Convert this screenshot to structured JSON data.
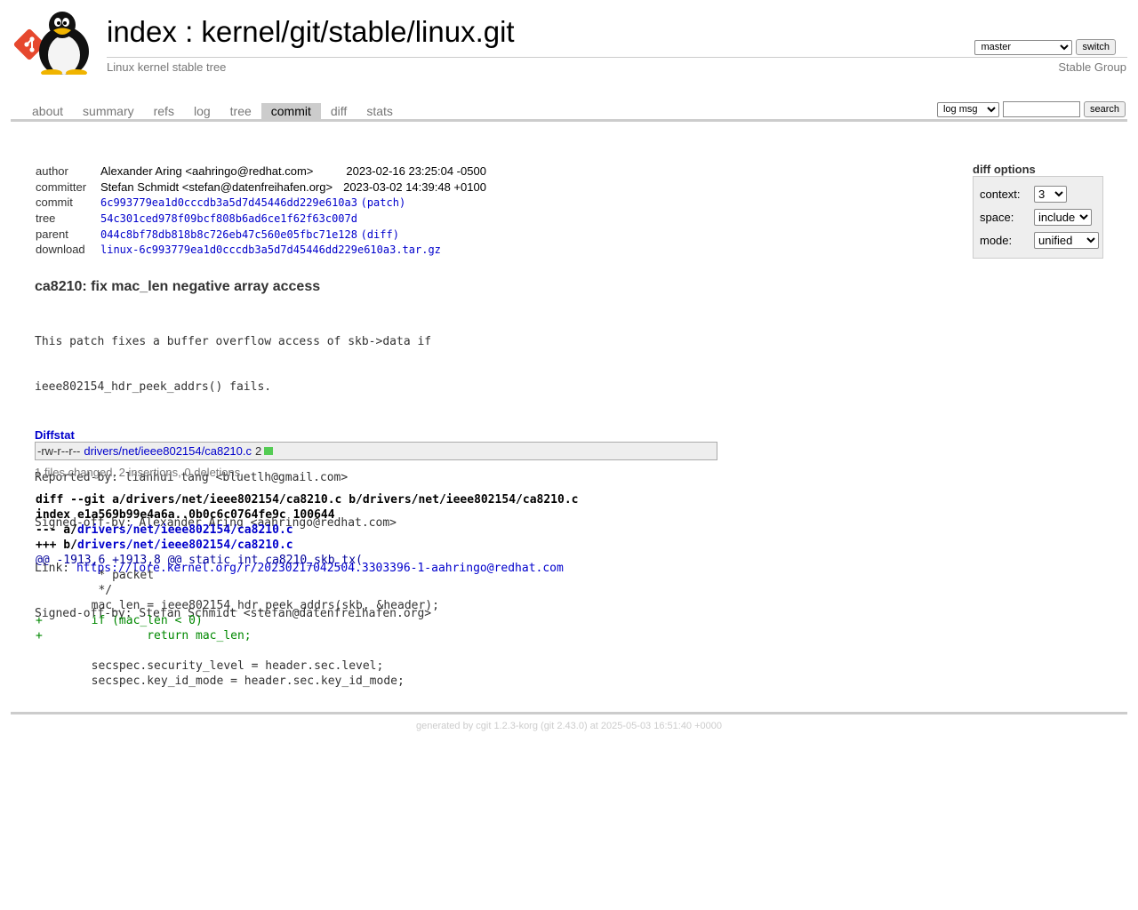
{
  "header": {
    "index_label": "index",
    "separator": ":",
    "repo_path": "kernel/git/stable/linux.git",
    "subtitle": "Linux kernel stable tree",
    "owner": "Stable Group",
    "branch_selected": "master",
    "switch_label": "switch"
  },
  "tabs": [
    {
      "label": "about"
    },
    {
      "label": "summary"
    },
    {
      "label": "refs"
    },
    {
      "label": "log"
    },
    {
      "label": "tree"
    },
    {
      "label": "commit",
      "active": true
    },
    {
      "label": "diff"
    },
    {
      "label": "stats"
    }
  ],
  "search": {
    "mode_selected": "log msg",
    "query": "",
    "button_label": "search"
  },
  "commit_info": {
    "author_label": "author",
    "author": "Alexander Aring <aahringo@redhat.com>",
    "author_date": "2023-02-16 23:25:04 -0500",
    "committer_label": "committer",
    "committer": "Stefan Schmidt <stefan@datenfreihafen.org>",
    "committer_date": "2023-03-02 14:39:48 +0100",
    "commit_label": "commit",
    "commit_hash": "6c993779ea1d0cccdb3a5d7d45446dd229e610a3",
    "patch_label": "(patch)",
    "tree_label": "tree",
    "tree_hash": "54c301ced978f09bcf808b6ad6ce1f62f63c007d",
    "parent_label": "parent",
    "parent_hash": "044c8bf78db818b8c726eb47c560e05fbc71e128",
    "diff_label": "(diff)",
    "download_label": "download",
    "download_file": "linux-6c993779ea1d0cccdb3a5d7d45446dd229e610a3.tar.gz"
  },
  "diff_options": {
    "title": "diff options",
    "context_label": "context:",
    "context_value": "3",
    "space_label": "space:",
    "space_value": "include",
    "mode_label": "mode:",
    "mode_value": "unified"
  },
  "commit": {
    "subject": "ca8210: fix mac_len negative array access",
    "message_lines": [
      "This patch fixes a buffer overflow access of skb->data if",
      "ieee802154_hdr_peek_addrs() fails.",
      "",
      "Reported-by: lianhui tang <bluetlh@gmail.com>",
      "Signed-off-by: Alexander Aring <aahringo@redhat.com>"
    ],
    "link_prefix": "Link: ",
    "link_url": "https://lore.kernel.org/r/20230217042504.3303396-1-aahringo@redhat.com",
    "message_tail": "Signed-off-by: Stefan Schmidt <stefan@datenfreihafen.org>"
  },
  "diffstat": {
    "title": "Diffstat",
    "mode": "-rw-r--r--",
    "file": "drivers/net/ieee802154/ca8210.c",
    "count": "2",
    "summary": "1 files changed, 2 insertions, 0 deletions"
  },
  "diff": {
    "git_line": "diff --git a/drivers/net/ieee802154/ca8210.c b/drivers/net/ieee802154/ca8210.c",
    "index_line": "index e1a569b99e4a6a..0b0c6c0764fe9c 100644",
    "minus_prefix": "--- a/",
    "minus_file": "drivers/net/ieee802154/ca8210.c",
    "plus_prefix": "+++ b/",
    "plus_file": "drivers/net/ieee802154/ca8210.c",
    "hunk": "@@ -1913,6 +1913,8 @@ static int ca8210_skb_tx(",
    "lines": [
      {
        "type": "ctx",
        "text": "         * packet"
      },
      {
        "type": "ctx",
        "text": "         */"
      },
      {
        "type": "ctx",
        "text": "        mac_len = ieee802154_hdr_peek_addrs(skb, &header);"
      },
      {
        "type": "add",
        "text": "+       if (mac_len < 0)"
      },
      {
        "type": "add",
        "text": "+               return mac_len;"
      },
      {
        "type": "ctx",
        "text": ""
      },
      {
        "type": "ctx",
        "text": "        secspec.security_level = header.sec.level;"
      },
      {
        "type": "ctx",
        "text": "        secspec.key_id_mode = header.sec.key_id_mode;"
      }
    ]
  },
  "footer": {
    "prefix": "generated by ",
    "cgit": "cgit 1.2.3-korg",
    "git": "(git 2.43.0)",
    "suffix": " at 2025-05-03 16:51:40 +0000"
  },
  "colors": {
    "link": "#0000cc",
    "add": "#008800",
    "hunk": "#000099",
    "rule": "#cccccc"
  }
}
